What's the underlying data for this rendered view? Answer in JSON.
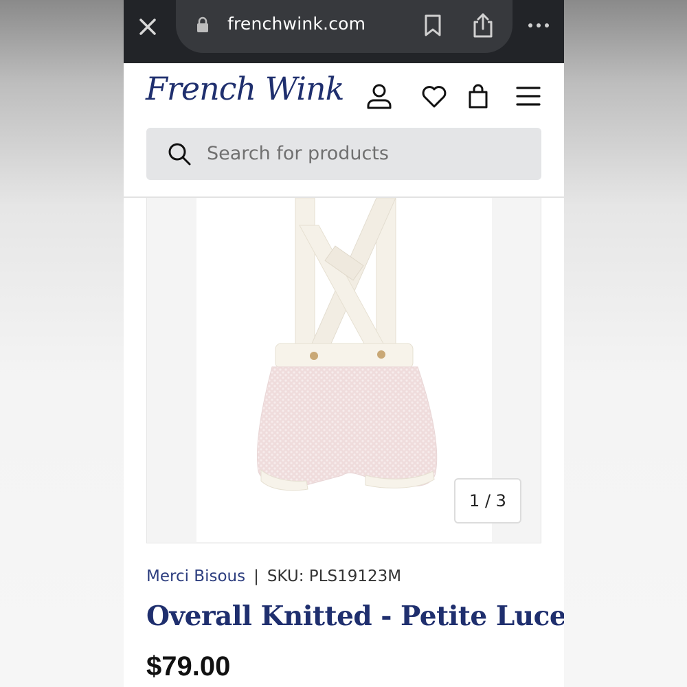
{
  "browser": {
    "url": "frenchwink.com",
    "icons": [
      "close-icon",
      "lock-icon",
      "bookmark-icon",
      "share-icon",
      "more-icon"
    ]
  },
  "header": {
    "logo_text": "French Wink",
    "icons": [
      "account-icon",
      "heart-icon",
      "bag-icon",
      "menu-icon"
    ]
  },
  "search": {
    "placeholder": "Search for products"
  },
  "gallery": {
    "counter": "1 / 3"
  },
  "product": {
    "brand": "Merci Bisous",
    "separator": "|",
    "sku": "SKU: PLS19123M",
    "title": "Overall Knitted - Petite Lucette",
    "price": "$79.00"
  },
  "colors": {
    "brand_navy": "#1f2f6e",
    "browser_bar": "#222428",
    "search_bg": "#e4e5e7"
  }
}
